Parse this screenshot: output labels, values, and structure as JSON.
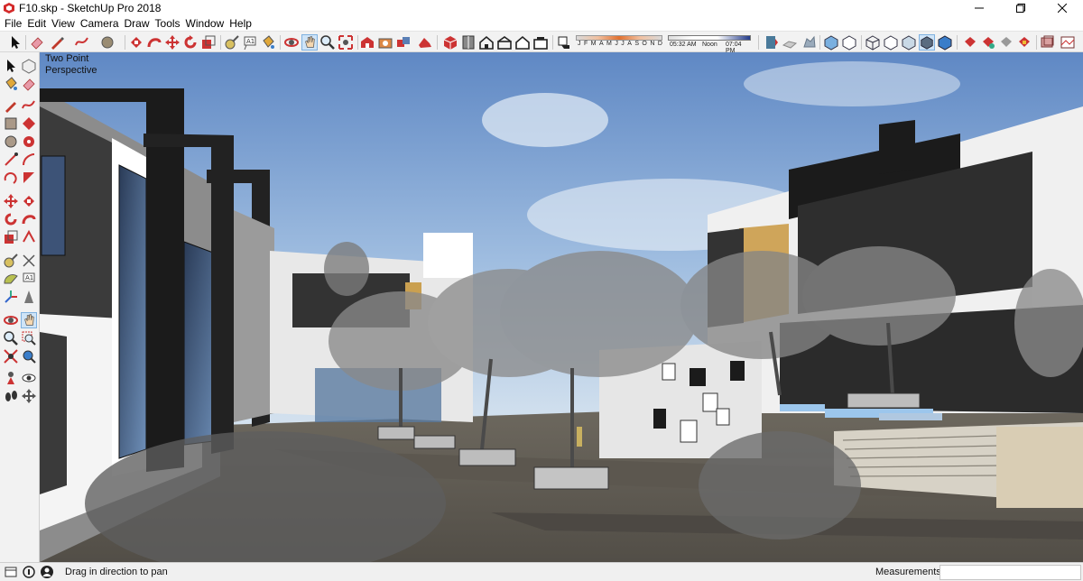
{
  "window": {
    "title": "F10.skp - SketchUp Pro 2018",
    "controls": [
      "minimize-icon",
      "maximize-icon",
      "close-icon"
    ]
  },
  "menu": [
    "File",
    "Edit",
    "View",
    "Camera",
    "Draw",
    "Tools",
    "Window",
    "Help"
  ],
  "toolbar": {
    "shadow_months": [
      "J",
      "F",
      "M",
      "A",
      "M",
      "J",
      "J",
      "A",
      "S",
      "O",
      "N",
      "D"
    ],
    "time_start": "05:32 AM",
    "time_noon": "Noon",
    "time_end": "07:04 PM",
    "icons": [
      "select-icon",
      "eraser-icon",
      "pencil-line-icon",
      "freehand-icon",
      "shape-icon",
      "push-pull-icon",
      "follow-me-icon",
      "move-icon",
      "rotate-icon",
      "scale-icon",
      "tape-measure-icon",
      "text-icon",
      "paint-bucket-icon",
      "orbit-icon",
      "pan-icon",
      "zoom-icon",
      "zoom-extents-icon",
      "warehouse-icon",
      "extension-icon",
      "components-icon",
      "iso-view-icon",
      "top-view-icon",
      "front-view-icon",
      "right-view-icon",
      "back-view-icon",
      "left-view-icon",
      "shadows-icon",
      "xray-icon",
      "back-edges-icon",
      "wireframe-icon",
      "hidden-line-icon",
      "shaded-icon",
      "shaded-textures-icon",
      "monochrome-icon",
      "section-icon",
      "layers-icon"
    ]
  },
  "left_tools": [
    "select-icon",
    "make-component-icon",
    "paint-bucket-icon",
    "eraser-icon",
    "line-icon",
    "arc-icon",
    "rectangle-icon",
    "rotated-rect-icon",
    "circle-icon",
    "polygon-icon",
    "freehand-icon",
    "pie-icon",
    "move-icon",
    "push-pull-icon",
    "rotate-icon",
    "follow-me-icon",
    "scale-icon",
    "offset-icon",
    "tape-measure-icon",
    "dimension-icon",
    "protractor-icon",
    "text-icon",
    "axes-icon",
    "3d-text-icon",
    "orbit-icon",
    "pan-icon",
    "zoom-icon",
    "zoom-window-icon",
    "zoom-extents-icon",
    "previous-view-icon",
    "position-camera-icon",
    "look-around-icon",
    "walk-icon",
    "section-plane-icon"
  ],
  "viewport": {
    "view_label_line1": "Two Point",
    "view_label_line2": "Perspective"
  },
  "status": {
    "text": "Drag in direction to pan",
    "measurements_label": "Measurements",
    "measurements_value": ""
  },
  "colors": {
    "sky_top": "#5f88c4",
    "sky_bottom": "#d6e3ef",
    "ground": "#6a6459",
    "wall_white": "#f2f2f2",
    "frame_black": "#1b1b1b",
    "tree_gray": "#8a8a8a",
    "active_tool": "#cfe4f7"
  }
}
